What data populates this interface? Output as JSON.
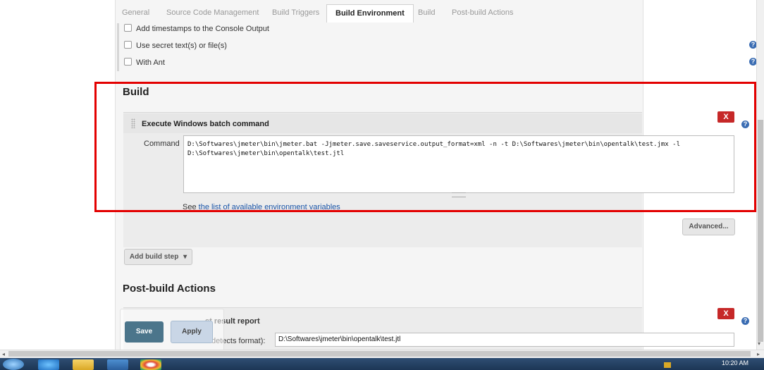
{
  "tabs": [
    "General",
    "Source Code Management",
    "Build Triggers",
    "Build Environment",
    "Build",
    "Post-build Actions"
  ],
  "active_tab": "Build Environment",
  "build_env_options": [
    "Add timestamps to the Console Output",
    "Use secret text(s) or file(s)",
    "With Ant"
  ],
  "build": {
    "title": "Build",
    "step_title": "Execute Windows batch command",
    "delete_label": "X",
    "command_label": "Command",
    "command_value": "D:\\Softwares\\jmeter\\bin\\jmeter.bat -Jjmeter.save.saveservice.output_format=xml -n -t D:\\Softwares\\jmeter\\bin\\opentalk\\test.jmx -l\nD:\\Softwares\\jmeter\\bin\\opentalk\\test.jtl",
    "see_prefix": "See",
    "env_link": "the list of available environment variables",
    "advanced_label": "Advanced...",
    "add_step_label": "Add build step"
  },
  "post_build": {
    "title": "Post-build Actions",
    "step_title": "st result report",
    "delete_label": "X",
    "field_label": "detects format):",
    "field_value": "D:\\Softwares\\jmeter\\bin\\opentalk\\test.jtl"
  },
  "footer": {
    "save_label": "Save",
    "apply_label": "Apply"
  },
  "taskbar": {
    "time": "10:20 AM"
  },
  "colors": {
    "highlight": "#e30000",
    "delete": "#c62828",
    "save": "#4b758b",
    "link": "#1a55a8"
  }
}
